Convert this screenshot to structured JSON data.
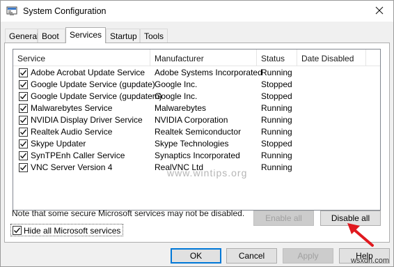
{
  "window": {
    "title": "System Configuration"
  },
  "tabs": [
    {
      "label": "General",
      "active": false
    },
    {
      "label": "Boot",
      "active": false
    },
    {
      "label": "Services",
      "active": true
    },
    {
      "label": "Startup",
      "active": false
    },
    {
      "label": "Tools",
      "active": false
    }
  ],
  "services_table": {
    "columns": [
      "Service",
      "Manufacturer",
      "Status",
      "Date Disabled"
    ],
    "rows": [
      {
        "checked": true,
        "service": "Adobe Acrobat Update Service",
        "manufacturer": "Adobe Systems Incorporated",
        "status": "Running",
        "date_disabled": ""
      },
      {
        "checked": true,
        "service": "Google Update Service (gupdate)",
        "manufacturer": "Google Inc.",
        "status": "Stopped",
        "date_disabled": ""
      },
      {
        "checked": true,
        "service": "Google Update Service (gupdatem)",
        "manufacturer": "Google Inc.",
        "status": "Stopped",
        "date_disabled": ""
      },
      {
        "checked": true,
        "service": "Malwarebytes Service",
        "manufacturer": "Malwarebytes",
        "status": "Running",
        "date_disabled": ""
      },
      {
        "checked": true,
        "service": "NVIDIA Display Driver Service",
        "manufacturer": "NVIDIA Corporation",
        "status": "Running",
        "date_disabled": ""
      },
      {
        "checked": true,
        "service": "Realtek Audio Service",
        "manufacturer": "Realtek Semiconductor",
        "status": "Running",
        "date_disabled": ""
      },
      {
        "checked": true,
        "service": "Skype Updater",
        "manufacturer": "Skype Technologies",
        "status": "Stopped",
        "date_disabled": ""
      },
      {
        "checked": true,
        "service": "SynTPEnh Caller Service",
        "manufacturer": "Synaptics Incorporated",
        "status": "Running",
        "date_disabled": ""
      },
      {
        "checked": true,
        "service": "VNC Server Version 4",
        "manufacturer": "RealVNC Ltd",
        "status": "Running",
        "date_disabled": ""
      }
    ]
  },
  "note": "Note that some secure Microsoft services may not be disabled.",
  "buttons": {
    "enable_all": "Enable all",
    "disable_all": "Disable all",
    "ok": "OK",
    "cancel": "Cancel",
    "apply": "Apply",
    "help": "Help"
  },
  "hide_ms_services": {
    "label": "Hide all Microsoft services",
    "checked": true
  },
  "watermarks": {
    "center": "www.wintips.org",
    "corner": "wsxdn.com"
  },
  "colors": {
    "arrow": "#e0191f",
    "focus": "#0078d7"
  },
  "icons": [
    "system-configuration-icon",
    "close-icon",
    "checkbox-checked-icon",
    "red-arrow-icon"
  ]
}
